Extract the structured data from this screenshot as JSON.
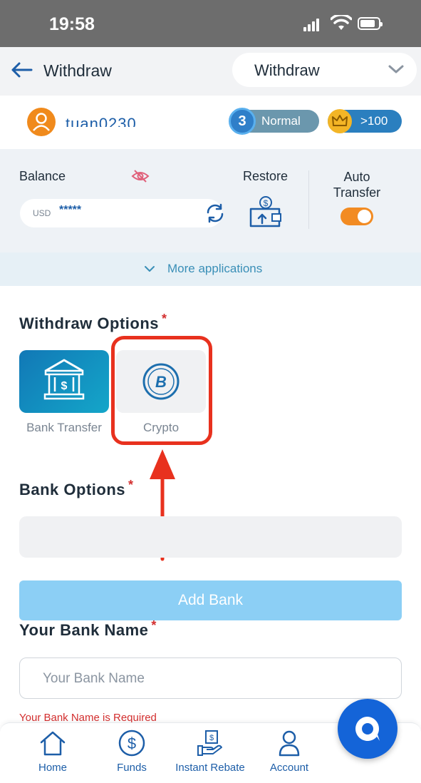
{
  "status_bar": {
    "time": "19:58"
  },
  "header": {
    "title": "Withdraw",
    "page_select_value": "Withdraw"
  },
  "user": {
    "username": "tuan0230",
    "level_label": "Normal",
    "level_number": "3",
    "vip_label": ">100"
  },
  "balance": {
    "label": "Balance",
    "currency": "USD",
    "amount_masked": "*****",
    "restore_label": "Restore",
    "auto_transfer_label": "Auto Transfer",
    "auto_transfer_on": true,
    "more_applications": "More applications"
  },
  "withdraw_options": {
    "heading": "Withdraw Options",
    "required_mark": "*",
    "options": [
      {
        "label": "Bank Transfer",
        "selected": true
      },
      {
        "label": "Crypto",
        "selected": false
      }
    ]
  },
  "bank_options": {
    "heading": "Bank Options",
    "required_mark": "*",
    "add_bank_label": "Add Bank"
  },
  "bank_name": {
    "heading": "Your Bank Name",
    "required_mark": "*",
    "placeholder": "Your Bank Name",
    "error": "Your Bank Name is Required"
  },
  "bottom_nav": [
    {
      "label": "Home",
      "icon": "home-icon"
    },
    {
      "label": "Funds",
      "icon": "dollar-circle-icon"
    },
    {
      "label": "Instant Rebate",
      "icon": "rebate-hand-icon"
    },
    {
      "label": "Account",
      "icon": "user-icon"
    }
  ],
  "colors": {
    "accent": "#1d5ea8",
    "highlight": "#e8311e",
    "toggle": "#f28b22",
    "add_bank": "#8ccff5"
  }
}
